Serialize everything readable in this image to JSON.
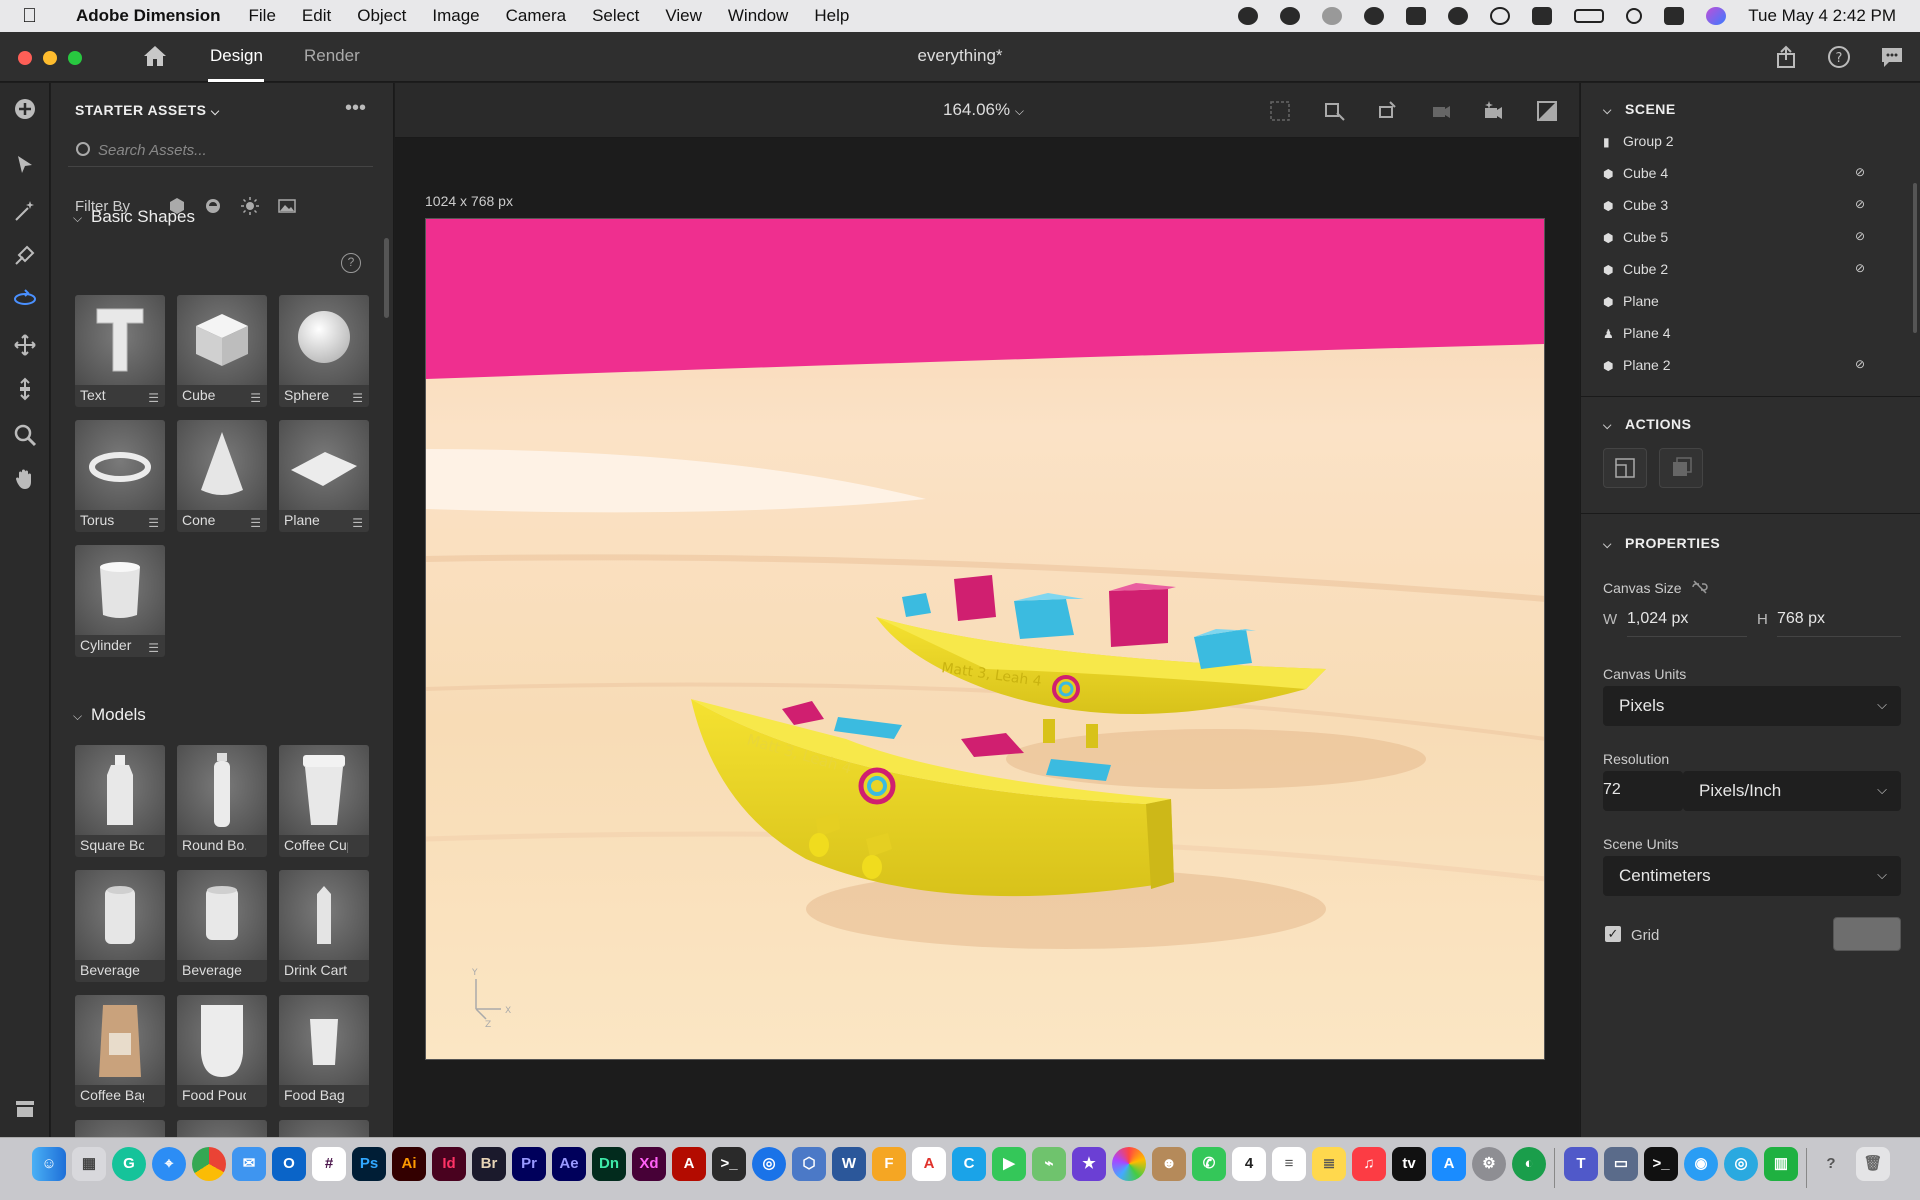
{
  "menubar": {
    "app_name": "Adobe Dimension",
    "items": [
      "File",
      "Edit",
      "Object",
      "Image",
      "Camera",
      "Select",
      "View",
      "Window",
      "Help"
    ],
    "clock": "Tue May 4  2:42 PM"
  },
  "titlebar": {
    "tab_design": "Design",
    "tab_render": "Render",
    "doc_title": "everything*"
  },
  "assets": {
    "title": "STARTER ASSETS",
    "search_placeholder": "Search Assets...",
    "filter_label": "Filter By",
    "basic_shapes_title": "Basic Shapes",
    "basic_shapes": [
      "Text",
      "Cube",
      "Sphere",
      "Torus",
      "Cone",
      "Plane",
      "Cylinder"
    ],
    "models_title": "Models",
    "models": [
      "Square Bo...",
      "Round Bo...",
      "Coffee Cup",
      "Beverage ...",
      "Beverage ...",
      "Drink Cart...",
      "Coffee Bag",
      "Food Pouch",
      "Food Bag"
    ]
  },
  "viewport": {
    "zoom": "164.06%",
    "canvas_size_label": "1024 x 768 px",
    "boat_text": "Matt 3, Leah 4"
  },
  "scene": {
    "title": "SCENE",
    "items": [
      {
        "label": "Group 2",
        "icon": "folder-icon",
        "hidden": false
      },
      {
        "label": "Cube 4",
        "icon": "cube-icon",
        "hidden": true
      },
      {
        "label": "Cube 3",
        "icon": "cube-icon",
        "hidden": true
      },
      {
        "label": "Cube 5",
        "icon": "cube-icon",
        "hidden": true
      },
      {
        "label": "Cube 2",
        "icon": "cube-icon",
        "hidden": true
      },
      {
        "label": "Plane",
        "icon": "cube-icon",
        "hidden": false
      },
      {
        "label": "Plane 4",
        "icon": "stamp-icon",
        "hidden": false
      },
      {
        "label": "Plane 2",
        "icon": "cube-icon",
        "hidden": true
      }
    ]
  },
  "actions": {
    "title": "ACTIONS"
  },
  "properties": {
    "title": "PROPERTIES",
    "canvas_size_label": "Canvas Size",
    "w_label": "W",
    "w_value": "1,024 px",
    "h_label": "H",
    "h_value": "768 px",
    "canvas_units_label": "Canvas Units",
    "canvas_units_value": "Pixels",
    "resolution_label": "Resolution",
    "resolution_value": "72",
    "resolution_units": "Pixels/Inch",
    "scene_units_label": "Scene Units",
    "scene_units_value": "Centimeters",
    "grid_label": "Grid",
    "grid_checked": true
  },
  "dock": {
    "apps": [
      "Finder",
      "Launchpad",
      "Grammarly",
      "Safari",
      "Chrome",
      "Mail",
      "Outlook",
      "Slack",
      "Ps",
      "Ai",
      "Id",
      "Br",
      "Pr",
      "Ae",
      "Dn",
      "Xd",
      "Acrobat",
      "Terminal",
      "Keynote",
      "Network",
      "Word",
      "F",
      "A",
      "C",
      "FaceTime",
      "Maps",
      "iMovie",
      "Photos",
      "Contacts",
      "Messages",
      "Calendar",
      "Reminders",
      "Notes",
      "Music",
      "tv",
      "App Store",
      "System Preferences",
      "Teams",
      "Preview",
      "Terminal",
      "Finder2",
      "Numbers",
      "Help",
      "Trash"
    ],
    "calendar_day": "4"
  },
  "colors": {
    "accent": "#4a90ff",
    "pink_wall": "#ef2f8f",
    "boat_yellow": "#f0dc1e",
    "cube_cyan": "#3bbbe0",
    "cube_magenta": "#d01f70"
  }
}
